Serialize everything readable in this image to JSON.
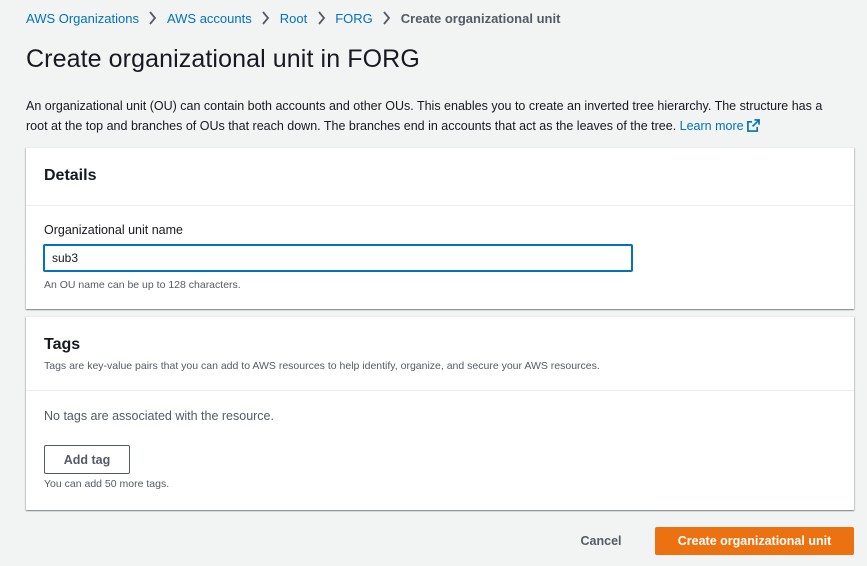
{
  "breadcrumb": {
    "items": [
      "AWS Organizations",
      "AWS accounts",
      "Root",
      "FORG"
    ],
    "current": "Create organizational unit"
  },
  "page": {
    "title": "Create organizational unit in FORG",
    "intro": "An organizational unit (OU) can contain both accounts and other OUs. This enables you to create an inverted tree hierarchy. The structure has a root at the top and branches of OUs that reach down. The branches end in accounts that act as the leaves of the tree.",
    "learn_more": "Learn more"
  },
  "details": {
    "heading": "Details",
    "field_label": "Organizational unit name",
    "field_value": "sub3",
    "field_hint": "An OU name can be up to 128 characters."
  },
  "tags": {
    "heading": "Tags",
    "description": "Tags are key-value pairs that you can add to AWS resources to help identify, organize, and secure your AWS resources.",
    "empty_text": "No tags are associated with the resource.",
    "add_label": "Add tag",
    "hint": "You can add 50 more tags."
  },
  "footer": {
    "cancel_label": "Cancel",
    "submit_label": "Create organizational unit"
  },
  "colors": {
    "link": "#0073bb",
    "primary": "#ec7211",
    "background": "#f2f3f3"
  }
}
